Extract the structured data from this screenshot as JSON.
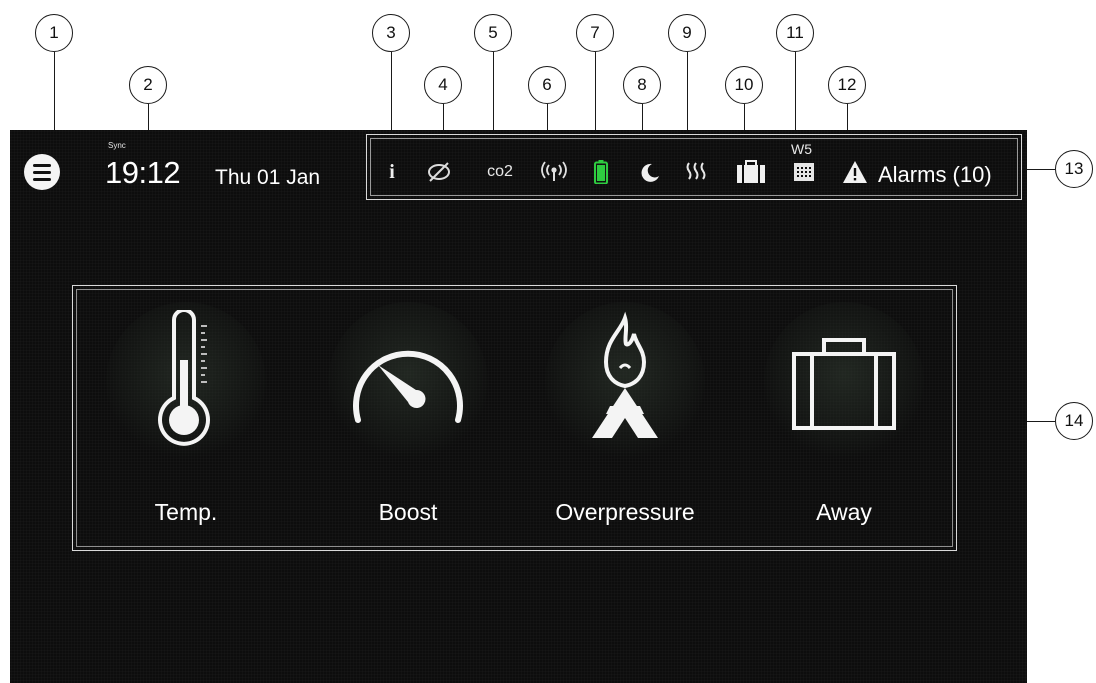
{
  "callouts": [
    "1",
    "2",
    "3",
    "4",
    "5",
    "6",
    "7",
    "8",
    "9",
    "10",
    "11",
    "12",
    "13",
    "14"
  ],
  "header": {
    "sync_label": "Sync",
    "time": "19:12",
    "date": "Thu 01 Jan"
  },
  "status_bar": {
    "icons": [
      "info-icon",
      "filter-off-icon",
      "co2-icon",
      "wireless-icon",
      "battery-icon",
      "moon-icon",
      "heat-icon",
      "suitcase-icon",
      "calendar-icon",
      "warning-icon"
    ],
    "co2_label": "co2",
    "info_label": "i",
    "week_label": "W5",
    "alarms_label": "Alarms (10)",
    "battery_color": "#2ecc40"
  },
  "tiles": [
    {
      "label": "Temp.",
      "icon": "thermometer-icon"
    },
    {
      "label": "Boost",
      "icon": "speedometer-icon"
    },
    {
      "label": "Overpressure",
      "icon": "fireplace-icon"
    },
    {
      "label": "Away",
      "icon": "suitcase-icon"
    }
  ]
}
